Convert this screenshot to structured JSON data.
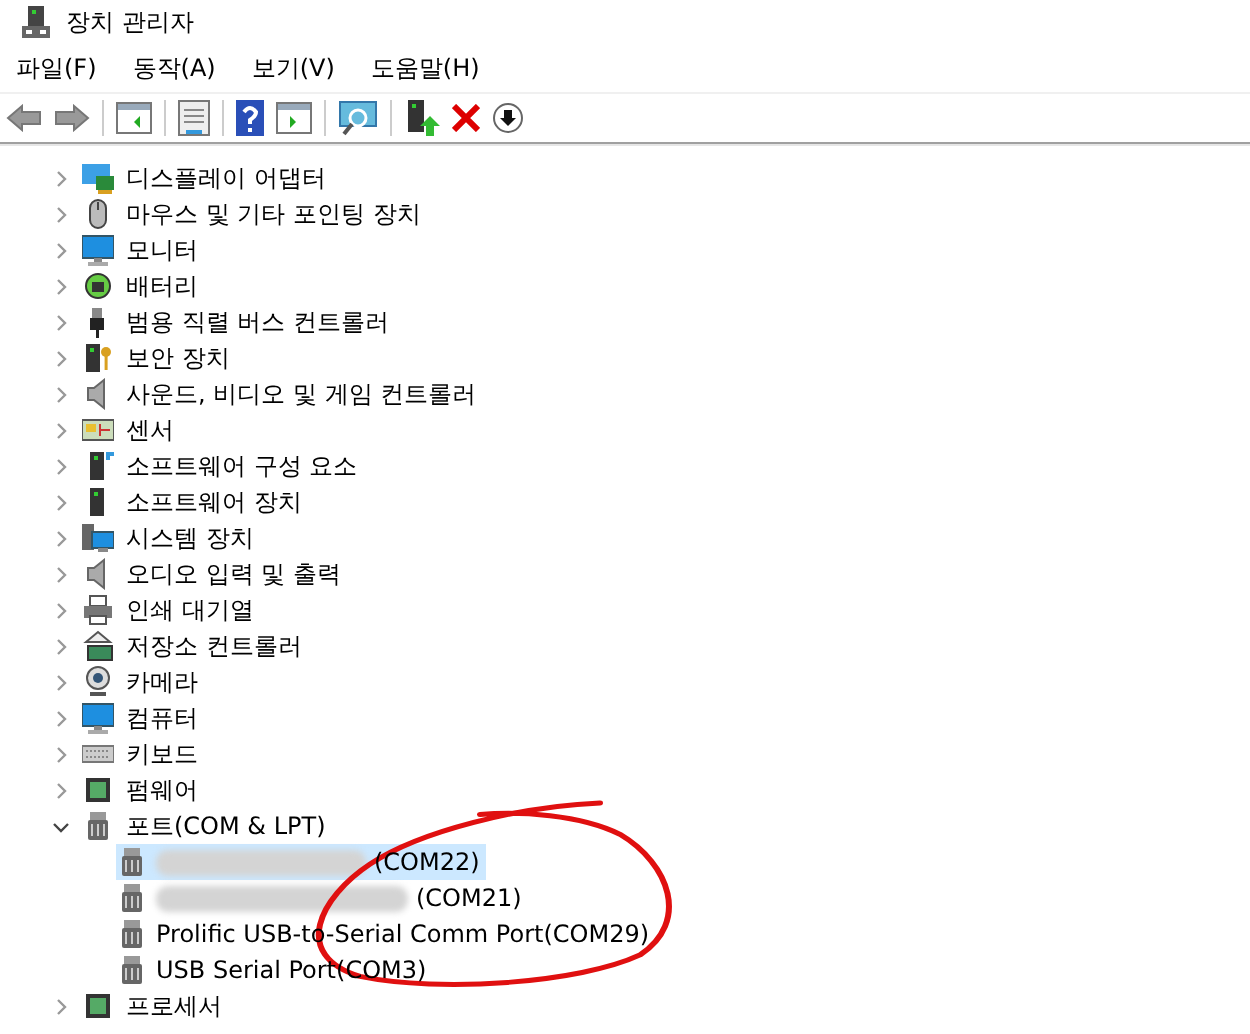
{
  "window": {
    "title": "장치 관리자"
  },
  "menu": [
    "파일(F)",
    "동작(A)",
    "보기(V)",
    "도움말(H)"
  ],
  "tree": [
    {
      "label": "디스플레이 어댑터",
      "expanded": false
    },
    {
      "label": "마우스 및 기타 포인팅 장치",
      "expanded": false
    },
    {
      "label": "모니터",
      "expanded": false
    },
    {
      "label": "배터리",
      "expanded": false
    },
    {
      "label": "범용 직렬 버스 컨트롤러",
      "expanded": false
    },
    {
      "label": "보안 장치",
      "expanded": false
    },
    {
      "label": "사운드, 비디오 및 게임 컨트롤러",
      "expanded": false
    },
    {
      "label": "센서",
      "expanded": false
    },
    {
      "label": "소프트웨어 구성 요소",
      "expanded": false
    },
    {
      "label": "소프트웨어 장치",
      "expanded": false
    },
    {
      "label": "시스템 장치",
      "expanded": false
    },
    {
      "label": "오디오 입력 및 출력",
      "expanded": false
    },
    {
      "label": "인쇄 대기열",
      "expanded": false
    },
    {
      "label": "저장소 컨트롤러",
      "expanded": false
    },
    {
      "label": "카메라",
      "expanded": false
    },
    {
      "label": "컴퓨터",
      "expanded": false
    },
    {
      "label": "키보드",
      "expanded": false
    },
    {
      "label": "펌웨어",
      "expanded": false
    },
    {
      "label": "포트(COM & LPT)",
      "expanded": true,
      "children": [
        {
          "label": "(COM22)",
          "redacted": true,
          "selected": true
        },
        {
          "label": "(COM21)",
          "redacted": true,
          "selected": false
        },
        {
          "label": "Prolific USB-to-Serial Comm Port(COM29)",
          "redacted": false,
          "selected": false
        },
        {
          "label": "USB Serial Port(COM3)",
          "redacted": false,
          "selected": false
        }
      ]
    },
    {
      "label": "프로세서",
      "expanded": false
    }
  ]
}
